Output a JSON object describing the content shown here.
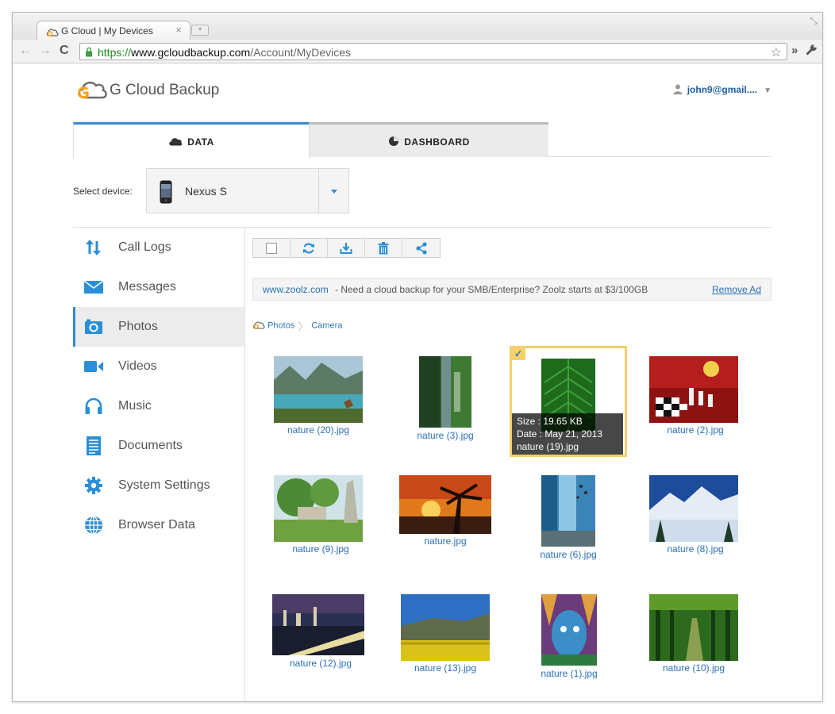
{
  "browser": {
    "tab_title": "G Cloud | My Devices",
    "tab_close": "×",
    "url_scheme": "https://",
    "url_host": "www.gcloudbackup.com",
    "url_path": "/Account/MyDevices"
  },
  "header": {
    "app_name": "G Cloud Backup",
    "user": "john9@gmail...."
  },
  "tabs": [
    {
      "label": "DATA",
      "icon": "cloud-icon",
      "active": true
    },
    {
      "label": "DASHBOARD",
      "icon": "pie-chart-icon",
      "active": false
    }
  ],
  "device": {
    "label": "Select device:",
    "selected": "Nexus S"
  },
  "sidebar": {
    "items": [
      {
        "label": "Call Logs",
        "icon": "arrows-updown-icon"
      },
      {
        "label": "Messages",
        "icon": "envelope-icon"
      },
      {
        "label": "Photos",
        "icon": "camera-icon",
        "active": true
      },
      {
        "label": "Videos",
        "icon": "video-camera-icon"
      },
      {
        "label": "Music",
        "icon": "headphones-icon"
      },
      {
        "label": "Documents",
        "icon": "document-icon"
      },
      {
        "label": "System Settings",
        "icon": "gear-icon"
      },
      {
        "label": "Browser Data",
        "icon": "globe-icon"
      }
    ]
  },
  "action_bar": [
    "select-all-checkbox",
    "refresh-icon",
    "download-icon",
    "trash-icon",
    "share-icon"
  ],
  "ad": {
    "link": "www.zoolz.com",
    "text": " - Need a cloud backup for your SMB/Enterprise? Zoolz starts at $3/100GB",
    "remove": "Remove Ad"
  },
  "breadcrumb": {
    "root": "Photos",
    "current": "Camera"
  },
  "photos": [
    {
      "name": "nature (20).jpg"
    },
    {
      "name": "nature (3).jpg"
    },
    {
      "name": "nature (19).jpg",
      "selected": true,
      "size": "Size : 19.65 KB",
      "date": "Date : May 21, 2013"
    },
    {
      "name": "nature (2).jpg"
    },
    {
      "name": "nature (9).jpg"
    },
    {
      "name": "nature.jpg"
    },
    {
      "name": "nature (6).jpg"
    },
    {
      "name": "nature (8).jpg"
    },
    {
      "name": "nature (12).jpg"
    },
    {
      "name": "nature (13).jpg"
    },
    {
      "name": "nature (1).jpg"
    },
    {
      "name": "nature (10).jpg"
    }
  ],
  "colors": {
    "accent": "#2e8fd4",
    "link": "#2b70b5",
    "selection": "#f5d06b",
    "logo_orange": "#f2a31c"
  }
}
